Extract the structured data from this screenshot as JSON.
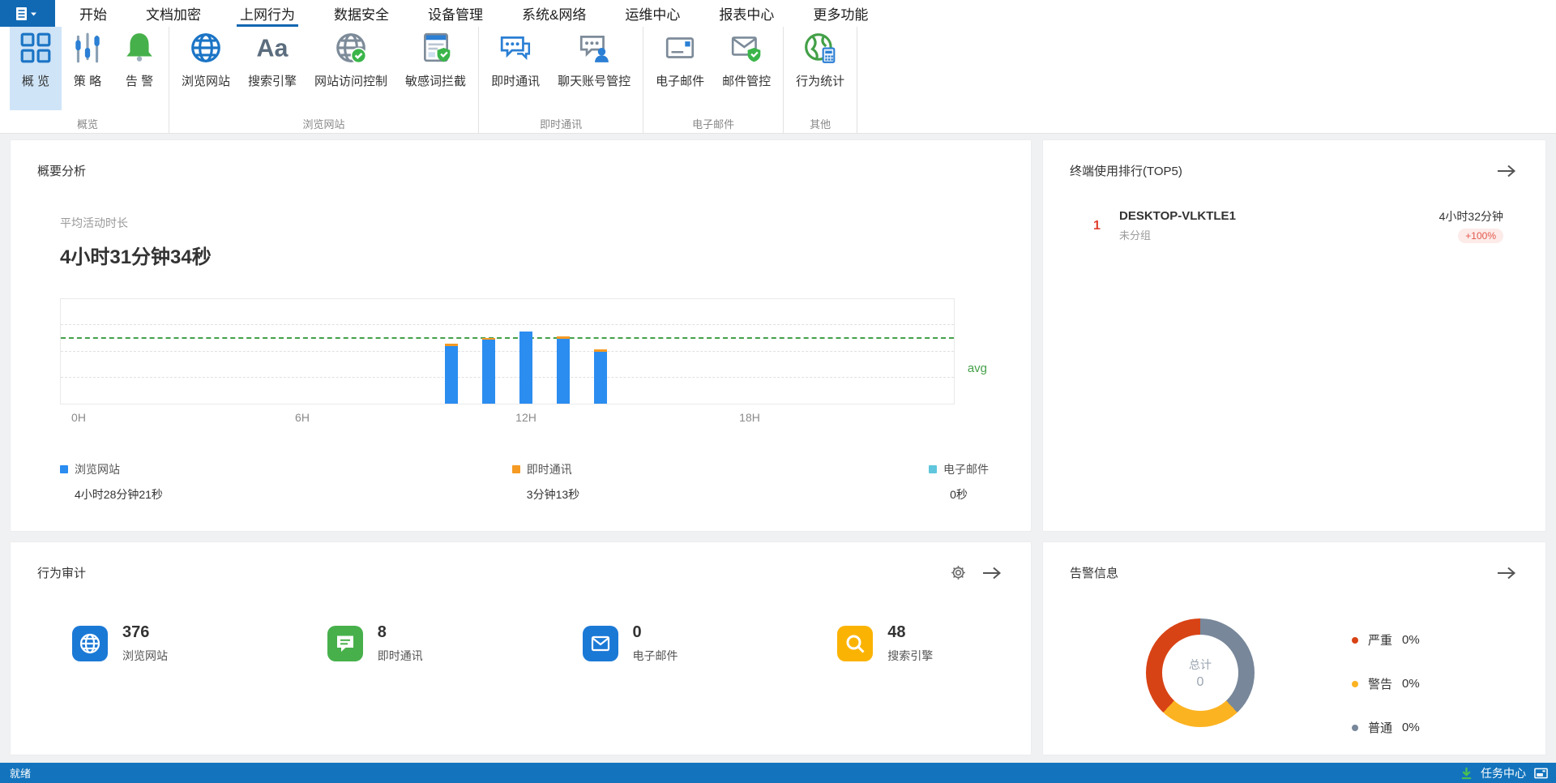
{
  "window": {
    "status_left": "就绪",
    "task_center": "任务中心"
  },
  "menu": {
    "items": [
      "开始",
      "文档加密",
      "上网行为",
      "数据安全",
      "设备管理",
      "系统&网络",
      "运维中心",
      "报表中心",
      "更多功能"
    ],
    "active": "上网行为"
  },
  "ribbon": {
    "groups": [
      {
        "label": "概览",
        "buttons": [
          {
            "label": "概 览",
            "icon": "overview-grid-icon",
            "selected": true
          },
          {
            "label": "策 略",
            "icon": "sliders-icon",
            "selected": false
          },
          {
            "label": "告 警",
            "icon": "bell-icon",
            "selected": false
          }
        ]
      },
      {
        "label": "浏览网站",
        "buttons": [
          {
            "label": "浏览网站",
            "icon": "globe-blue-icon",
            "selected": false
          },
          {
            "label": "搜索引擎",
            "icon": "aa-icon",
            "selected": false
          },
          {
            "label": "网站访问控制",
            "icon": "globe-check-icon",
            "selected": false
          },
          {
            "label": "敏感词拦截",
            "icon": "doc-shield-icon",
            "selected": false
          }
        ]
      },
      {
        "label": "即时通讯",
        "buttons": [
          {
            "label": "即时通讯",
            "icon": "chat-bubbles-icon",
            "selected": false
          },
          {
            "label": "聊天账号管控",
            "icon": "chat-person-icon",
            "selected": false
          }
        ]
      },
      {
        "label": "电子邮件",
        "buttons": [
          {
            "label": "电子邮件",
            "icon": "mail-icon",
            "selected": false
          },
          {
            "label": "邮件管控",
            "icon": "mail-shield-icon",
            "selected": false
          }
        ]
      },
      {
        "label": "其他",
        "buttons": [
          {
            "label": "行为统计",
            "icon": "globe-stats-icon",
            "selected": false
          }
        ]
      }
    ]
  },
  "summary": {
    "title": "概要分析",
    "metric_label": "平均活动时长",
    "metric_value": "4小时31分钟34秒",
    "legend": [
      {
        "name": "浏览网站",
        "value": "4小时28分钟21秒",
        "color": "#2b8df0"
      },
      {
        "name": "即时通讯",
        "value": "3分钟13秒",
        "color": "#f59a23"
      },
      {
        "name": "电子邮件",
        "value": "0秒",
        "color": "#5fc6dd"
      }
    ]
  },
  "chart_data": {
    "type": "bar",
    "x_ticks": [
      {
        "label": "0H",
        "hour": 0
      },
      {
        "label": "6H",
        "hour": 6
      },
      {
        "label": "12H",
        "hour": 12
      },
      {
        "label": "18H",
        "hour": 18
      }
    ],
    "x_range_hours": [
      0,
      24
    ],
    "bars": [
      {
        "hour_start": 10,
        "height_pct": 57,
        "cap_pct": 2
      },
      {
        "hour_start": 11,
        "height_pct": 63,
        "cap_pct": 2
      },
      {
        "hour_start": 12,
        "height_pct": 69,
        "cap_pct": 0
      },
      {
        "hour_start": 13,
        "height_pct": 64,
        "cap_pct": 2
      },
      {
        "hour_start": 14,
        "height_pct": 52,
        "cap_pct": 2
      }
    ],
    "avg_line": {
      "label": "avg",
      "height_pct": 62
    },
    "gridlines_pct": [
      25,
      50,
      75
    ],
    "colors": {
      "bar": "#2b8df0",
      "cap": "#f59a23",
      "avg": "#45a049"
    },
    "grid": "dashed-horizontal",
    "legend_position": "bottom"
  },
  "ranking": {
    "title": "终端使用排行(TOP5)",
    "rows": [
      {
        "rank": "1",
        "name": "DESKTOP-VLKTLE1",
        "group": "未分组",
        "duration": "4小时32分钟",
        "change": "+100%"
      }
    ]
  },
  "audit": {
    "title": "行为审计",
    "stats": [
      {
        "value": "376",
        "label": "浏览网站",
        "icon": "stat-globe-icon",
        "color": "#1b79d6"
      },
      {
        "value": "8",
        "label": "即时通讯",
        "icon": "stat-chat-icon",
        "color": "#47b04b"
      },
      {
        "value": "0",
        "label": "电子邮件",
        "icon": "stat-mail-icon",
        "color": "#1b79d6"
      },
      {
        "value": "48",
        "label": "搜索引擎",
        "icon": "stat-search-icon",
        "color": "#fbb303"
      }
    ]
  },
  "alarms": {
    "title": "告警信息",
    "donut": {
      "center_label": "总计",
      "center_value": "0",
      "ring": [
        {
          "color": "#78879a",
          "deg": 137
        },
        {
          "color": "#fbb321",
          "deg": 86
        },
        {
          "color": "#d84315",
          "deg": 137
        }
      ]
    },
    "legend": [
      {
        "name": "严重",
        "pct": "0%",
        "color": "#d84315"
      },
      {
        "name": "警告",
        "pct": "0%",
        "color": "#fbb321"
      },
      {
        "name": "普通",
        "pct": "0%",
        "color": "#78879a"
      }
    ]
  }
}
